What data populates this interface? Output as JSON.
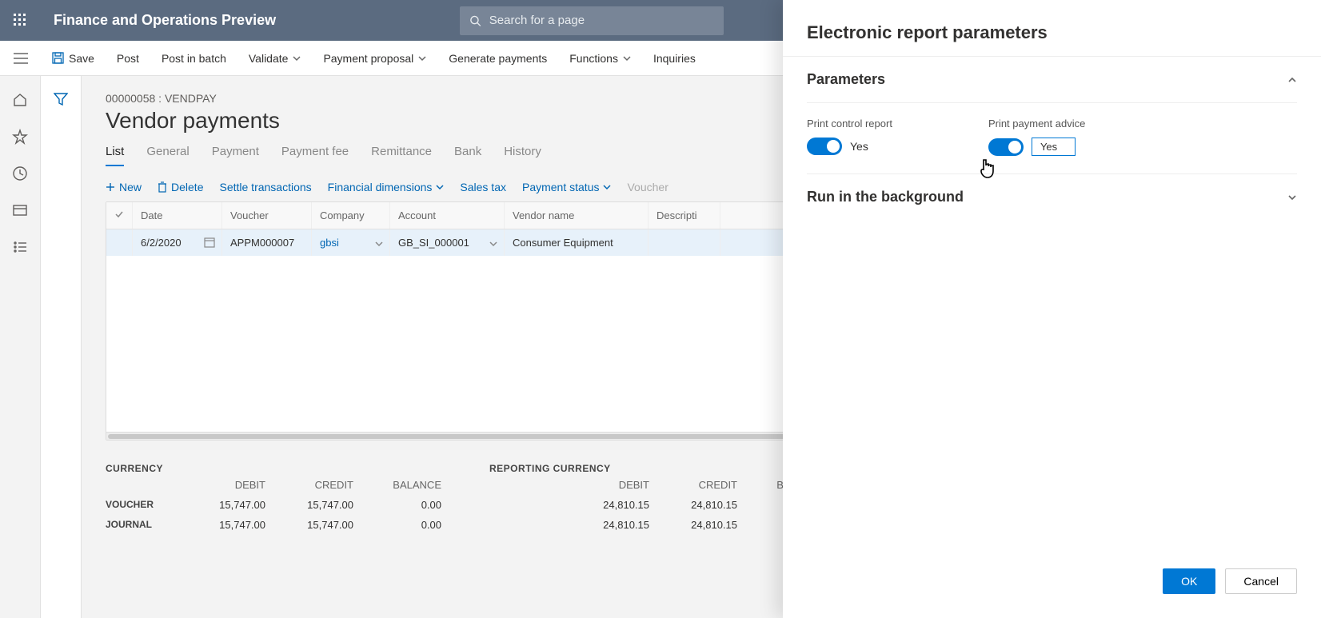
{
  "app_title": "Finance and Operations Preview",
  "search": {
    "placeholder": "Search for a page"
  },
  "commandbar": {
    "save": "Save",
    "post": "Post",
    "post_batch": "Post in batch",
    "validate": "Validate",
    "payment_proposal": "Payment proposal",
    "generate": "Generate payments",
    "functions": "Functions",
    "inquiries": "Inquiries"
  },
  "breadcrumb": "00000058 : VENDPAY",
  "page_title": "Vendor payments",
  "tabs": [
    "List",
    "General",
    "Payment",
    "Payment fee",
    "Remittance",
    "Bank",
    "History"
  ],
  "active_tab": "List",
  "subtoolbar": {
    "new": "New",
    "delete": "Delete",
    "settle": "Settle transactions",
    "findim": "Financial dimensions",
    "salestax": "Sales tax",
    "paystatus": "Payment status",
    "voucher": "Voucher"
  },
  "grid": {
    "headers": {
      "date": "Date",
      "voucher": "Voucher",
      "company": "Company",
      "account": "Account",
      "vendor": "Vendor name",
      "desc": "Descripti"
    },
    "row": {
      "date": "6/2/2020",
      "voucher": "APPM000007",
      "company": "gbsi",
      "account": "GB_SI_000001",
      "vendor": "Consumer Equipment"
    }
  },
  "totals": {
    "section1_title": "CURRENCY",
    "section2_title": "REPORTING CURRENCY",
    "cols": {
      "debit": "DEBIT",
      "credit": "CREDIT",
      "balance": "BALANCE"
    },
    "rows": {
      "voucher": "VOUCHER",
      "journal": "JOURNAL"
    },
    "currency": {
      "voucher": {
        "debit": "15,747.00",
        "credit": "15,747.00",
        "balance": "0.00"
      },
      "journal": {
        "debit": "15,747.00",
        "credit": "15,747.00",
        "balance": "0.00"
      }
    },
    "reporting": {
      "voucher": {
        "debit": "24,810.15",
        "credit": "24,810.15",
        "balance": ""
      },
      "journal": {
        "debit": "24,810.15",
        "credit": "24,810.15",
        "balance": ""
      }
    }
  },
  "panel": {
    "title": "Electronic report parameters",
    "parameters_title": "Parameters",
    "background_title": "Run in the background",
    "print_control_label": "Print control report",
    "print_control_value": "Yes",
    "print_advice_label": "Print payment advice",
    "print_advice_value": "Yes",
    "ok": "OK",
    "cancel": "Cancel"
  }
}
